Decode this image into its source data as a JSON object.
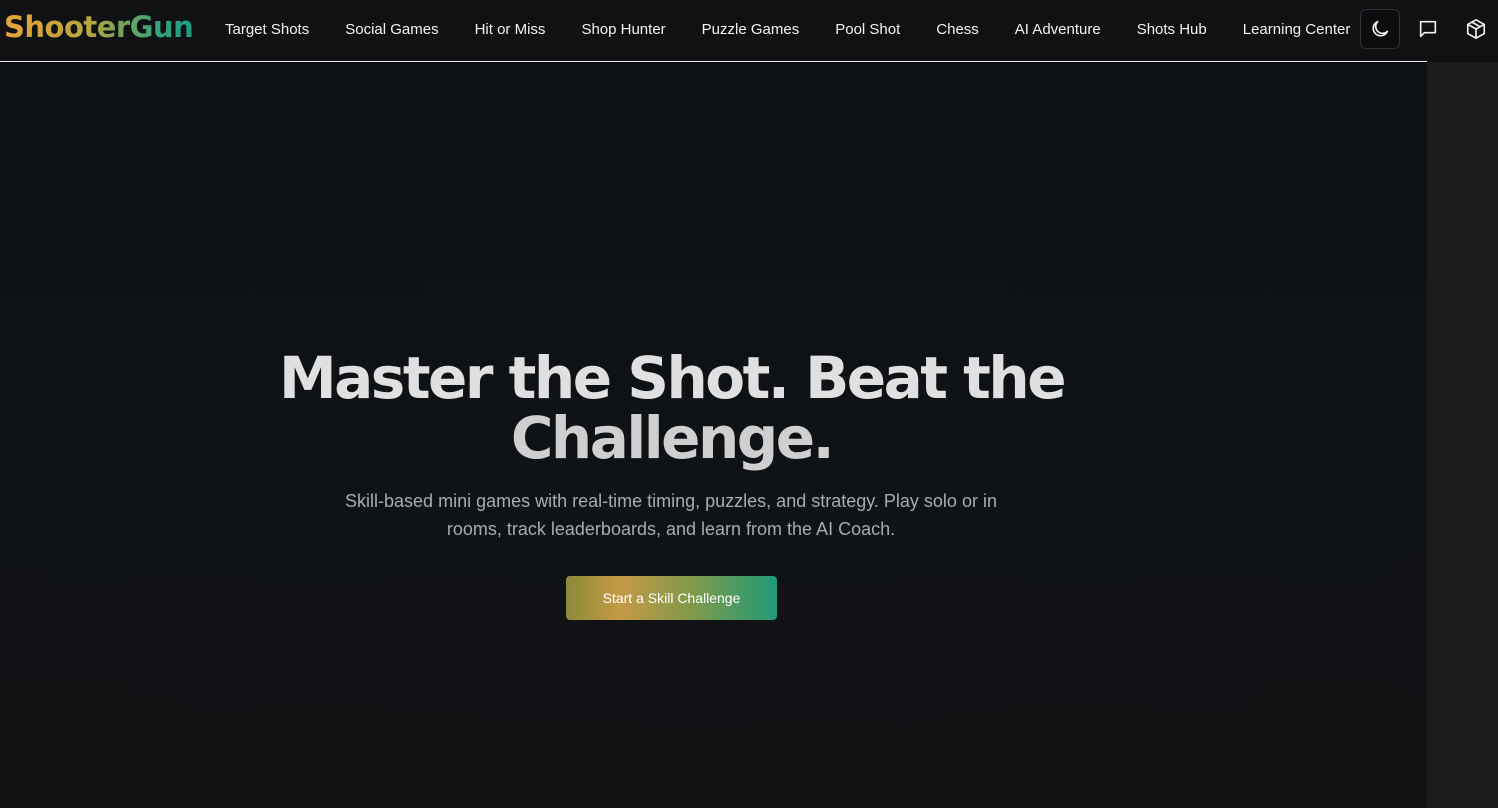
{
  "brand": {
    "name": "ShooterGun",
    "gradient_colors": [
      "#e8a33a",
      "#b6a540",
      "#3aa37a",
      "#1e9a82"
    ]
  },
  "nav": {
    "items": [
      {
        "label": "Target Shots"
      },
      {
        "label": "Social Games"
      },
      {
        "label": "Hit or Miss"
      },
      {
        "label": "Shop Hunter"
      },
      {
        "label": "Puzzle Games"
      },
      {
        "label": "Pool Shot"
      },
      {
        "label": "Chess"
      },
      {
        "label": "AI Adventure"
      },
      {
        "label": "Shots Hub"
      },
      {
        "label": "Learning Center"
      }
    ],
    "icons": {
      "theme": "moon-icon",
      "chat": "message-square-icon",
      "package": "package-icon"
    }
  },
  "hero": {
    "headline_line1": "Master the Shot. Beat the",
    "headline_line2": "Challenge.",
    "subtitle": "Skill-based mini games with real-time timing, puzzles, and strategy. Play solo or in rooms, track leaderboards, and learn from the AI Coach.",
    "cta_label": "Start a Skill Challenge"
  },
  "colors": {
    "background": "#0e1115",
    "navbar": "#101113",
    "text": "#f2f2f2",
    "muted_text": "#a8abb0",
    "cta_gradient": [
      "#c59a45",
      "#1f9a76"
    ]
  }
}
